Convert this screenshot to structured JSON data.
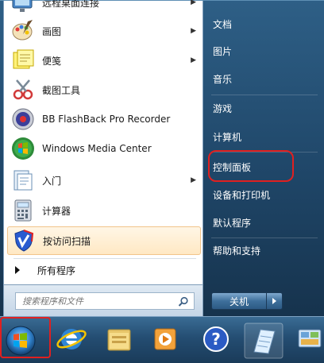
{
  "programs": [
    {
      "label": "远程桌面连接",
      "has_arrow": true
    },
    {
      "label": "画图",
      "has_arrow": true
    },
    {
      "label": "便笺",
      "has_arrow": true
    },
    {
      "label": "截图工具",
      "has_arrow": false
    },
    {
      "label": "BB FlashBack Pro Recorder",
      "has_arrow": false
    },
    {
      "label": "Windows Media Center",
      "has_arrow": false
    },
    {
      "label": "入门",
      "has_arrow": true
    },
    {
      "label": "计算器",
      "has_arrow": false
    },
    {
      "label": "按访问扫描",
      "has_arrow": false
    }
  ],
  "all_programs_label": "所有程序",
  "search": {
    "placeholder": "搜索程序和文件"
  },
  "right_links": [
    "文档",
    "图片",
    "音乐",
    "游戏",
    "计算机",
    "控制面板",
    "设备和打印机",
    "默认程序",
    "帮助和支持"
  ],
  "shutdown_label": "关机",
  "highlight_color": "#e02020",
  "taskbar_icons": [
    "start-orb-icon",
    "internet-explorer-icon",
    "file-explorer-icon",
    "media-player-icon",
    "help-icon",
    "notepad-icon",
    "control-panel-icon"
  ]
}
